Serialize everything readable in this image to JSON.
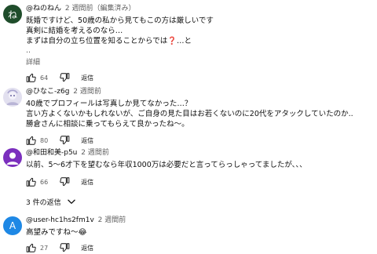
{
  "comments": [
    {
      "author": "@ねのねん",
      "time": "2 週間前（編集済み）",
      "avatar_letter": "ね",
      "avatar_color": "#1f4d2b",
      "lines": [
        "既婚ですけど、50歳の私から見てもこの方は厳しいです",
        "真剣に結婚を考えるのなら…",
        "まずは自分の立ち位置を知ることからでは❓…と",
        ".."
      ],
      "detail": "詳細",
      "likes": "64",
      "reply": "返信"
    },
    {
      "author": "@ひなこ-z6g",
      "time": "2 週間前",
      "avatar_color": "#c9c7e0",
      "lines": [
        "40歳でプロフィールは写真しか見てなかった…？",
        "言い方よくないかもしれないが、ご自身の見た目はお若くないのに20代をアタックしていたのか..",
        "勝倉さんに相談に乗ってもらえて良かったね〜。"
      ],
      "likes": "80",
      "reply": "返信"
    },
    {
      "author": "@和田和美-p5u",
      "time": "2 週間前",
      "avatar_color": "#7b2fbe",
      "lines": [
        "以前、5〜6才下を望むなら年収1000万は必要だと言ってらっしゃってましたが、、、"
      ],
      "likes": "66",
      "reply": "返信",
      "replies_label": "3 件の返信"
    },
    {
      "author": "@user-hc1hs2fm1v",
      "time": "2 週間前",
      "avatar_letter": "A",
      "avatar_color": "#1e88e5",
      "lines": [
        "高望みですね〜😂"
      ],
      "likes": "27",
      "reply": "返信"
    }
  ]
}
